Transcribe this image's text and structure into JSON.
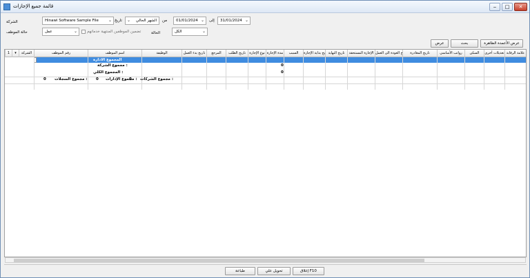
{
  "window": {
    "title": "قائمة جميع الإجازات",
    "min": "‒",
    "max": "□",
    "close": "✕"
  },
  "filters": {
    "company_label": "الشركة",
    "company_value": "Hinawi Software Sample File",
    "date_label": "تاريخ",
    "period_value": "الشهر الحالي",
    "from_label": "من",
    "from_date": "01/01/2024",
    "to_label": "إلى",
    "to_date": "31/01/2024",
    "emp_status_label": "حالة الموظف",
    "emp_status_value": "عمل",
    "include_label": "تضمين الموظفين المنتهية خدماتهم",
    "status_label": "الحالة",
    "status_value": "الكل"
  },
  "actions": {
    "show_columns": "عرض الأعمدة الظاهرة",
    "search": "بحث",
    "show": "عرض"
  },
  "columns": [
    "علامة الرقابة",
    "تعديلات أخرى",
    "السكن",
    "رواتب الأساسي",
    "تاريخ المغادرة",
    "تاريخ العودة الى العمل",
    "الإجازة المستحقة",
    "تاريخ النهاية",
    "تاريخ بداية الإجازة",
    "السبب",
    "مدة الإجازة",
    "نوع الإجازة",
    "تاريخ الطلب",
    "المرجع",
    "تاريخ بدء العمل",
    "الوظيفة",
    "اسم الموظف",
    "رقم الموظف",
    "الشركة"
  ],
  "groups": {
    "dept_total": "المجموع الادارة",
    "company_total": "مجموع الشركة :",
    "grand_total": "المجموع الكلي :",
    "zero": "0"
  },
  "footer": {
    "companies_label": "مجموع الشركات :",
    "companies_value": "0",
    "departments_label": "مجموع الإدارات :",
    "departments_value": "0",
    "records_label": "مجموع السجلات :",
    "records_value": "0"
  },
  "bottom_buttons": {
    "close": "إغلاق F10",
    "export": "تحويل علي",
    "print": "طباعة"
  }
}
